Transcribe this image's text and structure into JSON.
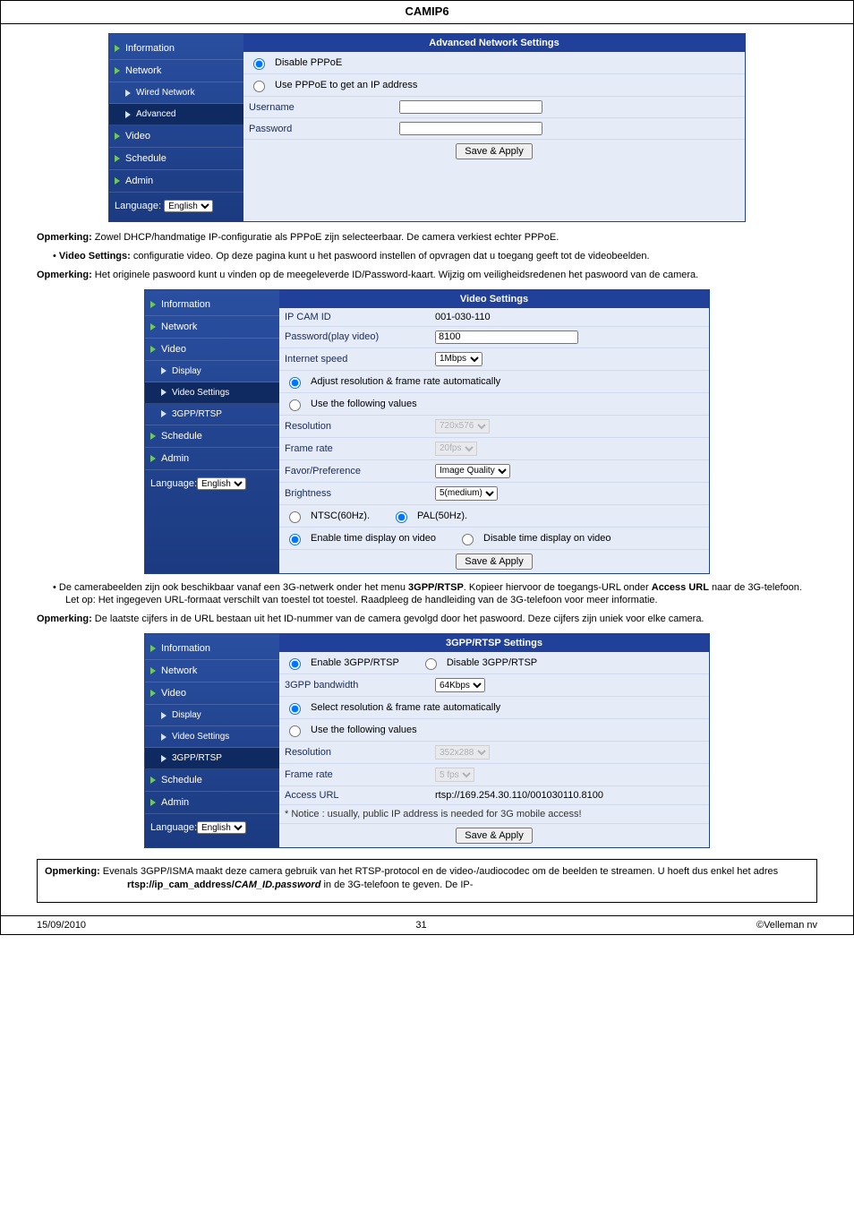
{
  "doc_title": "CAMIP6",
  "nav": {
    "information": "Information",
    "network": "Network",
    "wired": "Wired Network",
    "advanced": "Advanced",
    "video": "Video",
    "display": "Display",
    "videoSettings": "Video Settings",
    "gpprtsp": "3GPP/RTSP",
    "schedule": "Schedule",
    "admin": "Admin",
    "langLabel": "Language:",
    "langValue": "English"
  },
  "panel1": {
    "header": "Advanced Network Settings",
    "rows": {
      "disablePPPoE": "Disable PPPoE",
      "usePPPoE": "Use PPPoE to get an IP address",
      "username": "Username",
      "password": "Password",
      "save": "Save & Apply"
    }
  },
  "text": {
    "note1_label": "Opmerking:",
    "note1": " Zowel DHCP/handmatige IP-configuratie als PPPoE zijn selecteerbaar. De camera verkiest echter PPPoE.",
    "bullet1_a": "Video Settings:",
    "bullet1_b": " configuratie video. Op deze pagina kunt u het paswoord instellen of opvragen dat u toegang geeft tot de videobeelden.",
    "note2_label": "Opmerking:",
    "note2": " Het originele paswoord kunt u vinden op de meegeleverde ID/Password-kaart. Wijzig om veiligheidsredenen het paswoord van de camera.",
    "bullet2_a": " De camerabeelden zijn ook beschikbaar vanaf een 3G-netwerk onder het menu ",
    "bullet2_b": "3GPP/RTSP",
    "bullet2_c": ". Kopieer hiervoor de toegangs-URL onder ",
    "bullet2_d": "Access URL",
    "bullet2_e": " naar de 3G-telefoon. Let op: Het ingegeven URL-formaat verschilt van toestel tot toestel. Raadpleeg de handleiding van de 3G-telefoon voor meer informatie.",
    "note3_label": "Opmerking:",
    "note3": " De laatste cijfers in de URL bestaan uit het ID-nummer van de camera gevolgd door het paswoord. Deze cijfers zijn uniek voor elke camera.",
    "box_label": "Opmerking:",
    "box_a": " Evenals 3GPP/ISMA maakt deze camera gebruik van het RTSP-protocol en de video-/audiocodec om de beelden te streamen. U hoeft dus enkel het adres ",
    "box_b": "rtsp://ip_cam_address/",
    "box_c": "CAM_ID.password",
    "box_d": " in de 3G-telefoon te geven. De IP-"
  },
  "panel2": {
    "header": "Video Settings",
    "ipcamid_l": "IP CAM ID",
    "ipcamid_v": "001-030-110",
    "pwd_l": "Password(play video)",
    "pwd_v": "8100",
    "ispeed_l": "Internet speed",
    "ispeed_v": "1Mbps",
    "adjust": "Adjust resolution & frame rate automatically",
    "usefollow": "Use the following values",
    "res_l": "Resolution",
    "res_v": "720x576",
    "fr_l": "Frame rate",
    "fr_v": "20fps",
    "fav_l": "Favor/Preference",
    "fav_v": "Image Quality",
    "bri_l": "Brightness",
    "bri_v": "5(medium)",
    "ntsc": "NTSC(60Hz).",
    "pal": "PAL(50Hz).",
    "et": "Enable time display on video",
    "dt": "Disable time display on video",
    "save": "Save & Apply"
  },
  "panel3": {
    "header": "3GPP/RTSP Settings",
    "enable": "Enable 3GPP/RTSP",
    "disable": "Disable 3GPP/RTSP",
    "bw_l": "3GPP bandwidth",
    "bw_v": "64Kbps",
    "select": "Select resolution & frame rate automatically",
    "usefollow": "Use the following values",
    "res_l": "Resolution",
    "res_v": "352x288",
    "fr_l": "Frame rate",
    "fr_v": "5 fps",
    "url_l": "Access URL",
    "url_v": "rtsp://169.254.30.110/001030110.8100",
    "notice": "* Notice : usually, public IP address is needed for 3G mobile access!",
    "save": "Save & Apply"
  },
  "footer": {
    "date": "15/09/2010",
    "page": "31",
    "copy": "©Velleman nv"
  }
}
